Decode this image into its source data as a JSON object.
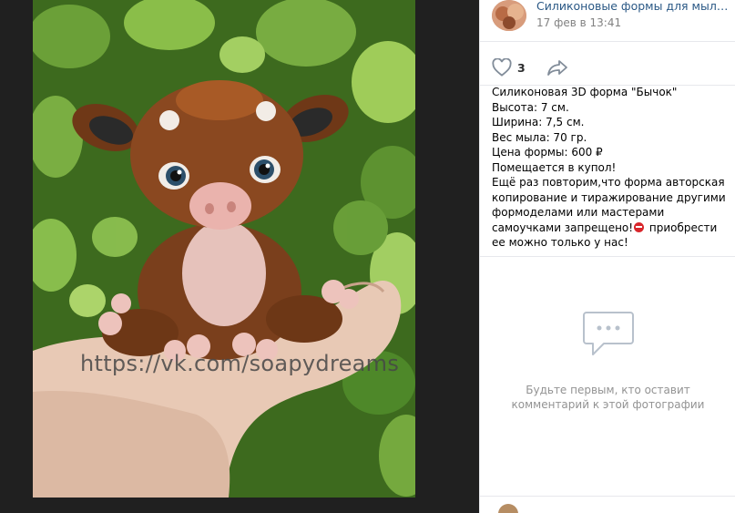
{
  "photo": {
    "watermark": "https://vk.com/soapydreams"
  },
  "author": {
    "name": "Силиконовые формы для мыла. М...",
    "date": "17 фев в 13:41"
  },
  "actions": {
    "likes": "3"
  },
  "description": {
    "line1": "Силиконовая 3D форма \"Бычок\"",
    "line2": "Высота: 7 см.",
    "line3": "Ширина: 7,5 см.",
    "line4": "Вес мыла: 70 гр.",
    "line5": "Цена формы: 600 ₽",
    "line6": "Помещается в купол!",
    "para_main": "Ещё раз повторим,что форма авторская копирование и тиражирование другими формоделами или мастерами самоучками запрещено!",
    "para_tail": " приобрести ее можно только у нас!"
  },
  "comments": {
    "empty_line1": "Будьте первым, кто оставит",
    "empty_line2": "комментарий к этой фотографии"
  },
  "colors": {
    "link": "#2a5885",
    "meta": "#828282",
    "border": "#e7e8ec",
    "ban": "#d8262b"
  },
  "icons": [
    "heart-icon",
    "share-arrow-icon",
    "comment-bubble-icon",
    "ban-icon"
  ]
}
